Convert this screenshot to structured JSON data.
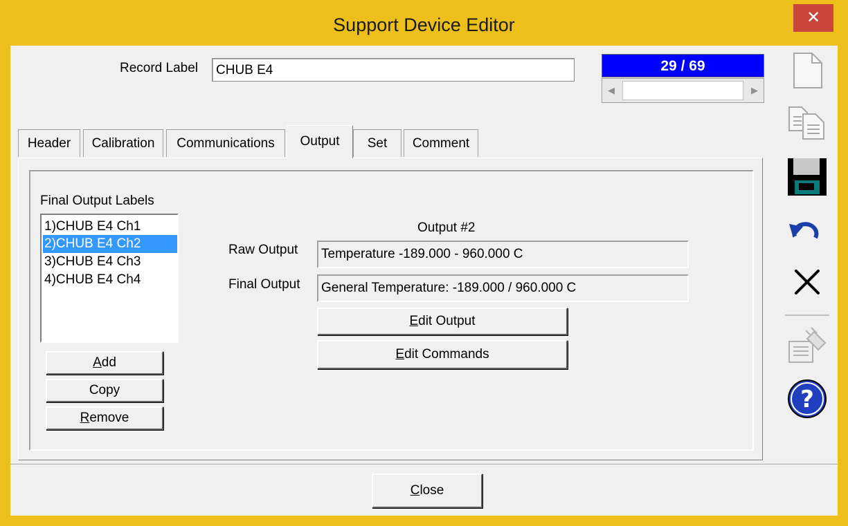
{
  "window": {
    "title": "Support Device Editor",
    "close_glyph": "✕"
  },
  "record": {
    "label": "Record Label",
    "value": "CHUB E4",
    "position": "29 / 69"
  },
  "tabs": [
    {
      "label": "Header"
    },
    {
      "label": "Calibration"
    },
    {
      "label": "Communications"
    },
    {
      "label": "Output"
    },
    {
      "label": "Set"
    },
    {
      "label": "Comment"
    }
  ],
  "active_tab": "Output",
  "output": {
    "labels_title": "Final Output Labels",
    "items": [
      {
        "label": "1)CHUB E4 Ch1"
      },
      {
        "label": "2)CHUB E4 Ch2"
      },
      {
        "label": "3)CHUB E4 Ch3"
      },
      {
        "label": "4)CHUB E4 Ch4"
      }
    ],
    "selected_index": 1,
    "add": {
      "accel": "A",
      "rest": "dd"
    },
    "copy": "Copy",
    "remove": {
      "accel": "R",
      "rest": "emove"
    },
    "output_title": "Output #2",
    "raw_label": "Raw Output",
    "raw_value": "Temperature -189.000 - 960.000 C",
    "final_label": "Final Output",
    "final_value": "General Temperature: -189.000 / 960.000 C",
    "edit_output": {
      "accel": "E",
      "rest": "dit Output"
    },
    "edit_commands": {
      "accel": "E",
      "rest": "dit Commands"
    }
  },
  "close": {
    "accel": "C",
    "rest": "lose"
  },
  "toolbar_icons": [
    "new-document-icon",
    "copy-icon",
    "save-icon",
    "undo-icon",
    "delete-icon",
    "wizard-icon",
    "help-icon"
  ],
  "colors": {
    "title_bar": "#ecbf1a",
    "close_button": "#c9463d",
    "record_counter_bg": "#0000ff",
    "selection": "#3399ff",
    "help_blue": "#1f3fbf"
  }
}
